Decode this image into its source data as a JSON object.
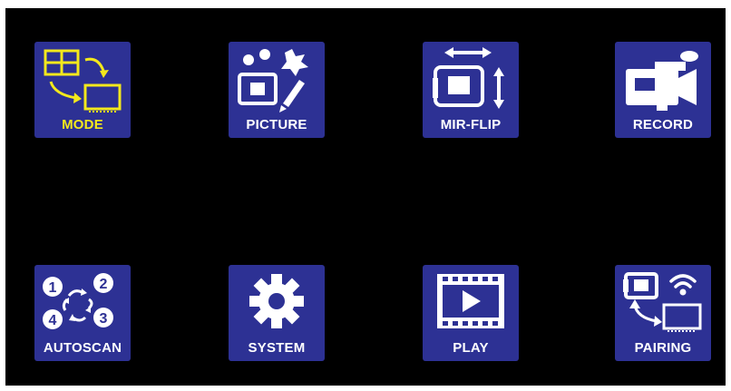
{
  "colors": {
    "tile_background": "#2d3194",
    "icon": "#ffffff",
    "active_accent": "#f3e81c",
    "screen_background": "#000000"
  },
  "menu": {
    "selected": "mode",
    "items": [
      {
        "id": "mode",
        "label": "MODE",
        "icon": "split-screen-mode-icon"
      },
      {
        "id": "picture",
        "label": "PICTURE",
        "icon": "picture-settings-icon"
      },
      {
        "id": "mir_flip",
        "label": "MIR-FLIP",
        "icon": "mirror-flip-icon"
      },
      {
        "id": "record",
        "label": "RECORD",
        "icon": "video-camera-icon"
      },
      {
        "id": "autoscan",
        "label": "AUTOSCAN",
        "icon": "autoscan-cycle-icon"
      },
      {
        "id": "system",
        "label": "SYSTEM",
        "icon": "gear-icon"
      },
      {
        "id": "play",
        "label": "PLAY",
        "icon": "film-play-icon"
      },
      {
        "id": "pairing",
        "label": "PAIRING",
        "icon": "wireless-pairing-icon"
      }
    ]
  }
}
